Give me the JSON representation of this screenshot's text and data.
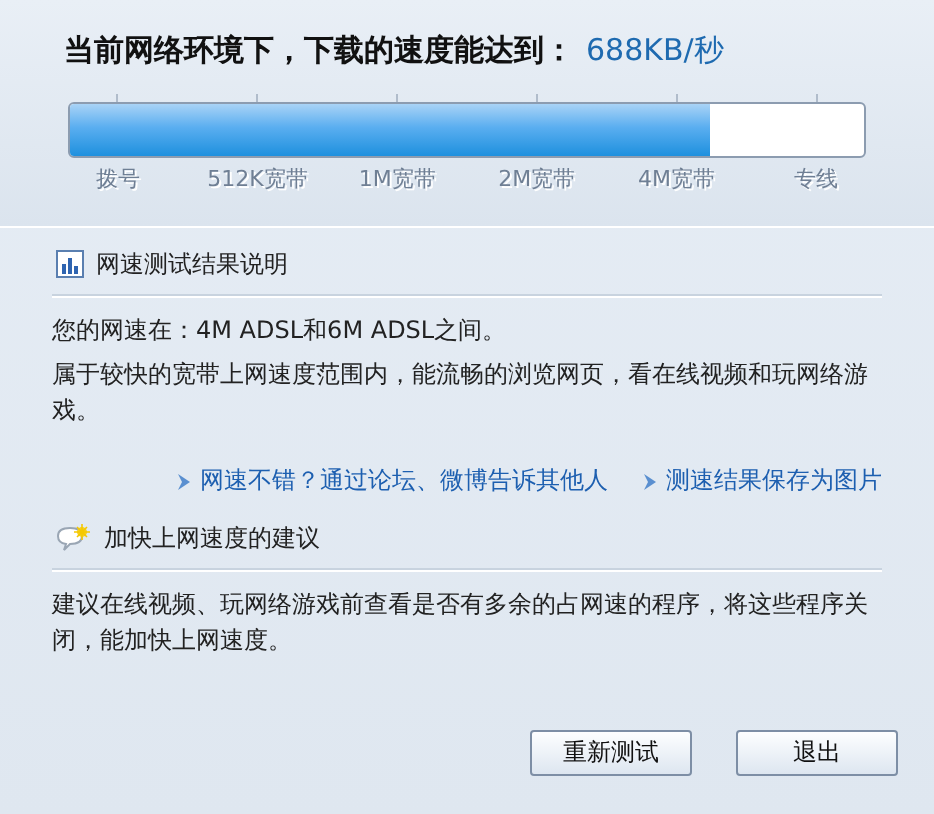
{
  "headline": {
    "label": "当前网络环境下，下载的速度能达到：",
    "speed": "688KB/秒"
  },
  "speed_meter": {
    "level": 0.805,
    "ticks": [
      "拨号",
      "512K宽带",
      "1M宽带",
      "2M宽带",
      "4M宽带",
      "专线"
    ]
  },
  "sections": [
    {
      "kind": "result",
      "title": "网速测试结果说明",
      "paragraphs": [
        "您的网速在：4M ADSL和6M ADSL之间。",
        "属于较快的宽带上网速度范围内，能流畅的浏览网页，看在线视频和玩网络游戏。"
      ],
      "links": [
        "网速不错？通过论坛、微博告诉其他人",
        "测速结果保存为图片"
      ]
    },
    {
      "kind": "tip",
      "title": "加快上网速度的建议",
      "paragraphs": [
        "建议在线视频、玩网络游戏前查看是否有多余的占网速的程序，将这些程序关闭，能加快上网速度。"
      ]
    }
  ],
  "buttons": [
    "重新测试",
    "退出"
  ]
}
